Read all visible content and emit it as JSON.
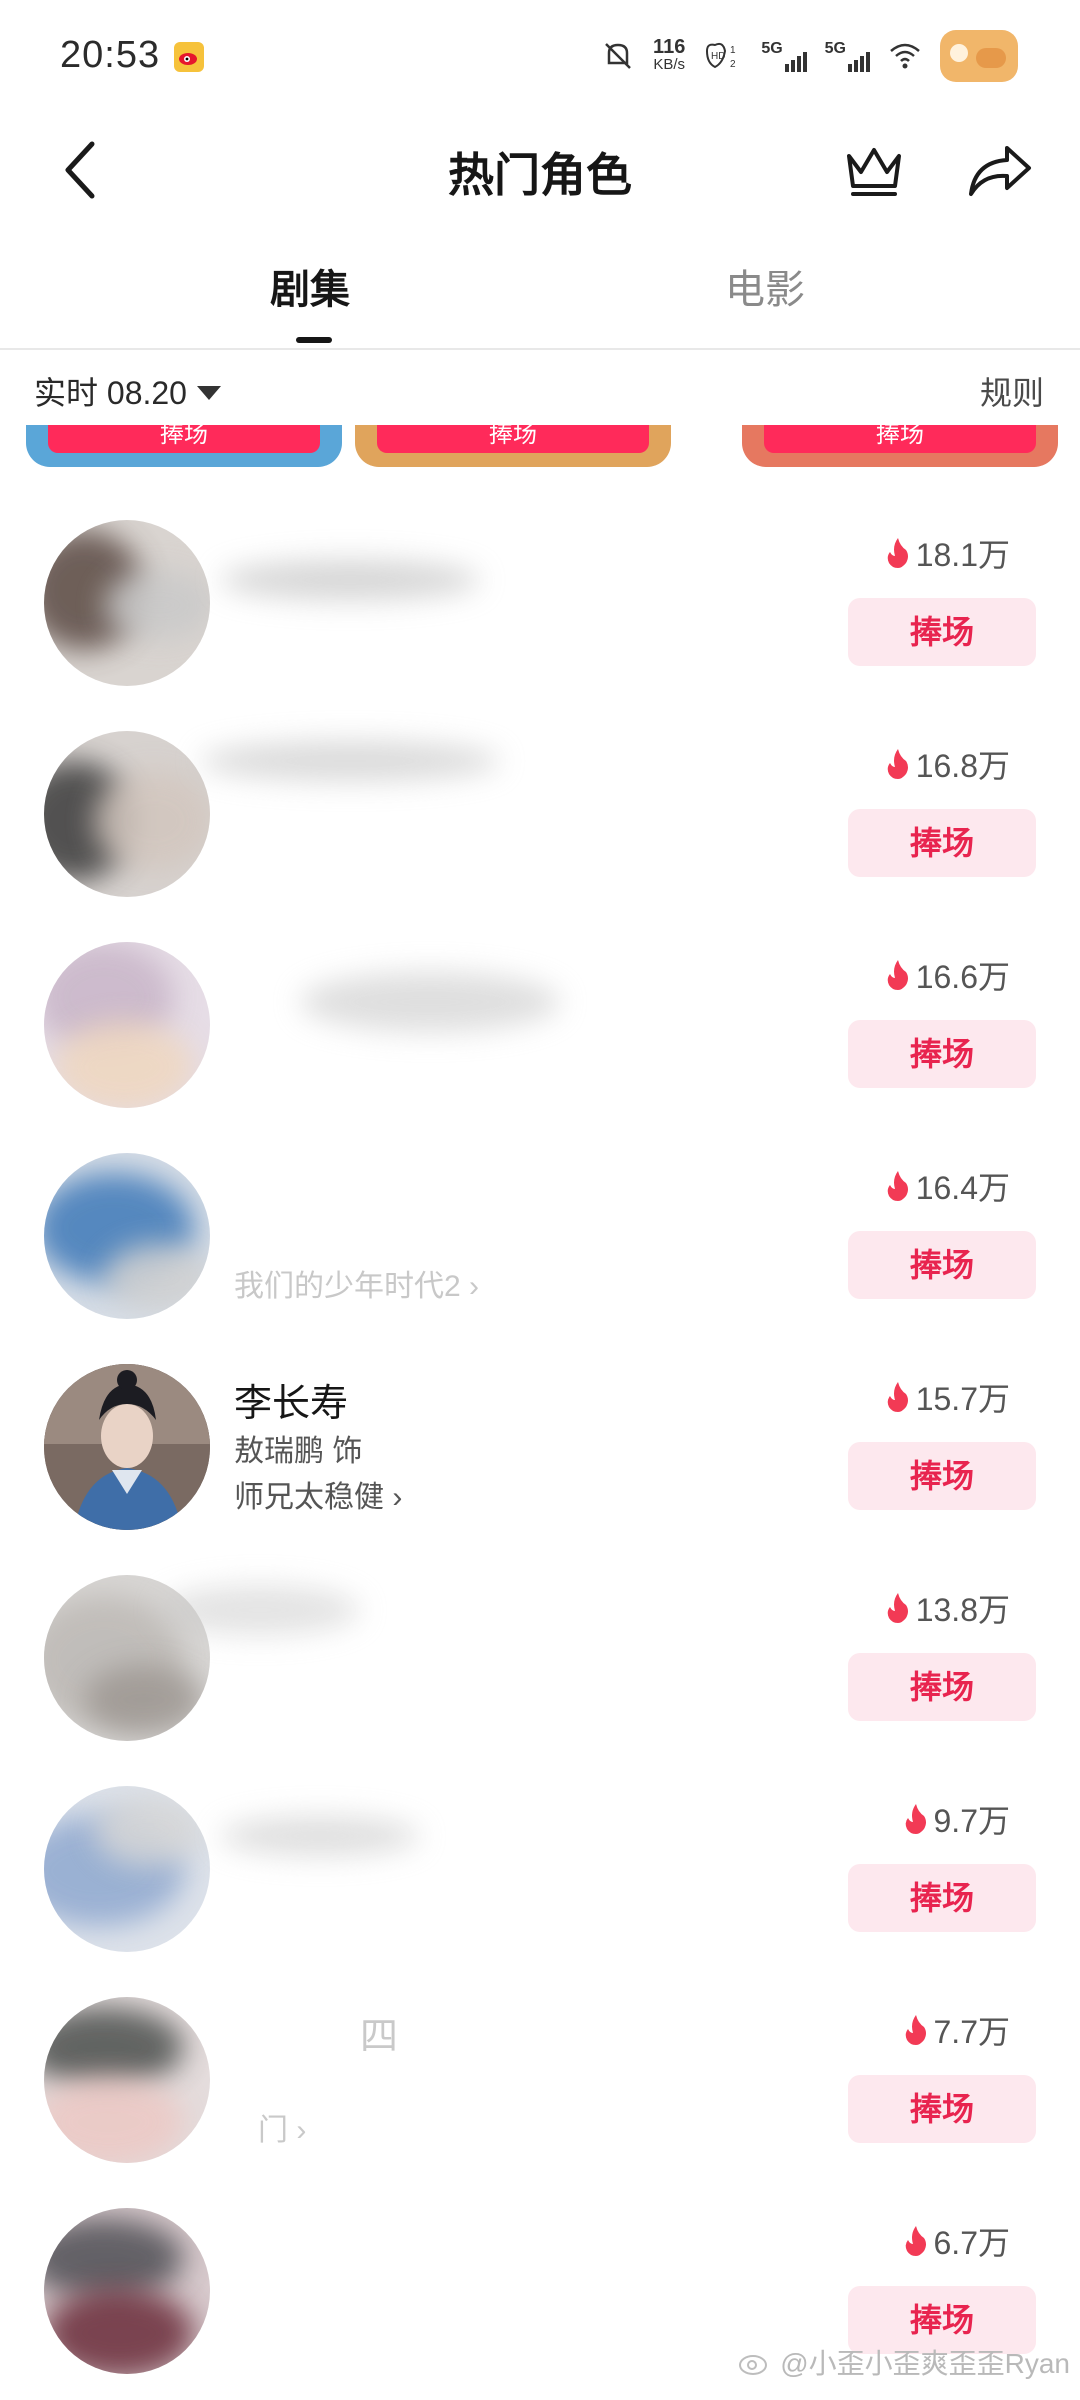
{
  "status_bar": {
    "time": "20:53",
    "net_speed_value": "116",
    "net_speed_unit": "KB/s",
    "sim1": "5G",
    "sim2": "5G",
    "icons": [
      "mute-icon",
      "weibo-icon",
      "hd-icon",
      "signal-icon",
      "wifi-icon",
      "cat-sticker-icon"
    ]
  },
  "header": {
    "title": "热门角色"
  },
  "tabs": [
    {
      "label": "剧集",
      "active": true
    },
    {
      "label": "电影",
      "active": false
    }
  ],
  "filter": {
    "date_label": "实时 08.20",
    "rules_label": "规则"
  },
  "podium_partial": {
    "button_label": "捧场"
  },
  "ranking": [
    {
      "heat": "18.1万",
      "button": "捧场"
    },
    {
      "heat": "16.8万",
      "button": "捧场"
    },
    {
      "heat": "16.6万",
      "button": "捧场"
    },
    {
      "heat": "16.4万",
      "drama": "我们的少年时代2 ›",
      "button": "捧场"
    },
    {
      "name": "李长寿",
      "actor": "敖瑞鹏 饰",
      "drama": "师兄太稳健 ›",
      "heat": "15.7万",
      "button": "捧场"
    },
    {
      "heat": "13.8万",
      "button": "捧场"
    },
    {
      "heat": "9.7万",
      "button": "捧场"
    },
    {
      "name": "四",
      "drama": "门 ›",
      "heat": "7.7万",
      "button": "捧场"
    },
    {
      "heat": "6.7万",
      "button": "捧场"
    }
  ],
  "watermark": "@小歪小歪爽歪歪Ryan",
  "colors": {
    "accent": "#e8244f",
    "button_bg": "#fde8ee",
    "flame": "#f23a55"
  }
}
